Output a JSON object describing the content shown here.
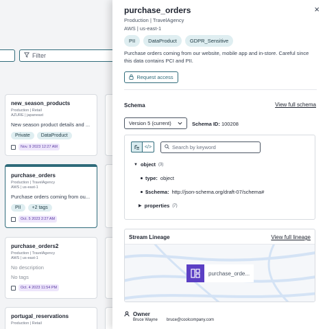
{
  "background": {
    "filter_placeholder": "Filter",
    "cards": [
      {
        "title": "new_season_products",
        "env": "Production | Retail",
        "cloud": "AZURE | japaneast",
        "description": "New season product details and ...",
        "tags": [
          "Private",
          "DataProduct"
        ],
        "date": "Nov. 9 2023 12:27 AM"
      },
      {
        "title": "purchase_orders",
        "env": "Production | TravelAgency",
        "cloud": "AWS | us-east-1",
        "description": "Purchase orders coming from ou...",
        "tags": [
          "PII",
          "+2 tags"
        ],
        "date": "Oct. 5 2023 2:27 AM"
      },
      {
        "title": "purchase_orders2",
        "env": "Production | TravelAgency",
        "cloud": "AWS | us-east-1",
        "description": "No description",
        "tags_text": "No tags",
        "date": "Oct. 4 2023 11:54 PM"
      },
      {
        "title": "portugal_reservations",
        "env": "Production | Retail",
        "cloud": ""
      }
    ]
  },
  "drawer": {
    "title": "purchase_orders",
    "env": "Production | TravelAgency",
    "cloud": "AWS | us-east-1",
    "tags": [
      "PII",
      "DataProduct",
      "GDPR_Sensitive"
    ],
    "description": "Purchase orders coming from our website, mobile app and in-store. Careful since this data contains PCI and PII.",
    "request_access": "Request access",
    "schema_label": "Schema",
    "view_full_schema": "View full schema",
    "version_select": "Version 5 (current)",
    "schema_id_label": "Schema ID:",
    "schema_id_value": "100208",
    "search_placeholder": "Search by keyword",
    "tree": {
      "object_key": "object",
      "object_count": "(3)",
      "type_key": "type:",
      "type_val": "object",
      "schema_key": "$schema:",
      "schema_val": "http://json-schema.org/draft-07/schema#",
      "properties_key": "properties",
      "properties_count": "(7)"
    },
    "lineage_title": "Stream Lineage",
    "view_full_lineage": "View full lineage",
    "lineage_node": "purchase_orde...",
    "owner_label": "Owner",
    "owner_name": "Bruce Wayne",
    "owner_email": "bruce@coolcompany.com"
  },
  "colors": {
    "accent": "#2f6b7a",
    "tag_bg": "#dfeef1",
    "date_bg": "#ede5fb",
    "node": "#5b3fc4"
  },
  "icons": [
    "filter-icon",
    "lock-icon",
    "chevron-down-icon",
    "search-icon",
    "tree-view-icon",
    "code-view-icon",
    "calendar-icon",
    "topic-icon",
    "user-icon",
    "close-icon"
  ]
}
